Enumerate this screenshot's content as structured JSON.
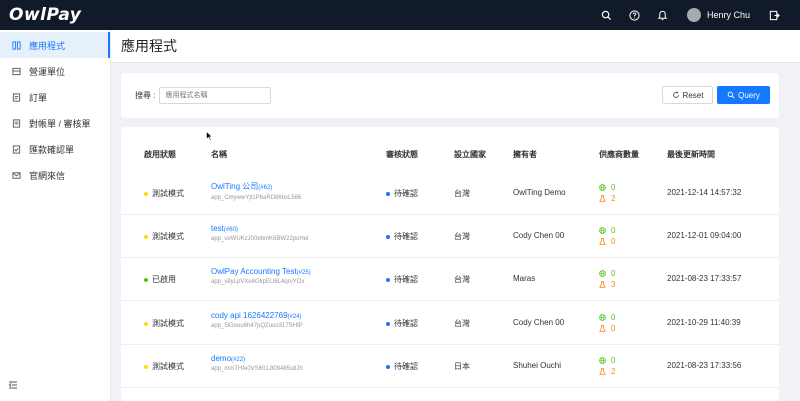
{
  "app": {
    "logo": "OwlPay"
  },
  "user": {
    "name": "Henry Chu"
  },
  "sidebar": {
    "items": [
      {
        "label": "應用程式",
        "icon": "apps-icon",
        "active": true
      },
      {
        "label": "營運單位",
        "icon": "building-icon",
        "active": false
      },
      {
        "label": "訂單",
        "icon": "order-icon",
        "active": false
      },
      {
        "label": "對帳單 / 審核單",
        "icon": "statement-icon",
        "active": false
      },
      {
        "label": "匯款確認單",
        "icon": "remittance-icon",
        "active": false
      },
      {
        "label": "官網來信",
        "icon": "mail-icon",
        "active": false
      }
    ]
  },
  "page": {
    "title": "應用程式"
  },
  "search": {
    "label": "搜尋 :",
    "placeholder": "應用程式名稱",
    "reset_label": "Reset",
    "query_label": "Query"
  },
  "table": {
    "headers": {
      "status": "啟用狀態",
      "name": "名稱",
      "review": "審核狀態",
      "country": "設立國家",
      "owner": "擁有者",
      "suppliers": "供應商數量",
      "updated": "最後更新時間"
    },
    "rows": [
      {
        "status": "測試模式",
        "status_color": "#fadb14",
        "name": "OwlTing 公司",
        "name_id": "(#62)",
        "app_id": "app_CmywwYjt1P6aRD86bxL566",
        "review": "待確認",
        "country": "台灣",
        "owner": "OwlTing Demo",
        "sup_green": "0",
        "sup_orange": "2",
        "updated": "2021-12-14 14:57:32"
      },
      {
        "status": "測試模式",
        "status_color": "#fadb14",
        "name": "test",
        "name_id": "(#60)",
        "app_id": "app_uvWUKzJ00ebmK6BW22poHel",
        "review": "待確認",
        "country": "台灣",
        "owner": "Cody Chen 00",
        "sup_green": "0",
        "sup_orange": "0",
        "updated": "2021-12-01 09:04:00"
      },
      {
        "status": "已啟用",
        "status_color": "#52c41a",
        "name": "OwlPay Accounting Test",
        "name_id": "(#25)",
        "app_id": "app_v8yLpVXe8GkpEU6L4qrvYOx",
        "review": "待確認",
        "country": "台灣",
        "owner": "Maras",
        "sup_green": "0",
        "sup_orange": "3",
        "updated": "2021-08-23 17:33:57"
      },
      {
        "status": "測試模式",
        "status_color": "#fadb14",
        "name": "cody api 1626422769",
        "name_id": "(#24)",
        "app_id": "app_5lGoou6h47pQZuuo317SHfP",
        "review": "待確認",
        "country": "台灣",
        "owner": "Cody Chen 00",
        "sup_green": "0",
        "sup_orange": "0",
        "updated": "2021-10-29 11:40:39"
      },
      {
        "status": "測試模式",
        "status_color": "#fadb14",
        "name": "demo",
        "name_id": "(#22)",
        "app_id": "app_mmTHfe0VS601Jt09485s8Jh",
        "review": "待確認",
        "country": "日本",
        "owner": "Shuhei Ouchi",
        "sup_green": "0",
        "sup_orange": "2",
        "updated": "2021-08-23 17:33:56"
      }
    ]
  },
  "colors": {
    "primary": "#1677ff",
    "topbar": "#111a28",
    "pending_dot": "#1677ff",
    "green": "#52c41a",
    "orange": "#fa8c16"
  }
}
